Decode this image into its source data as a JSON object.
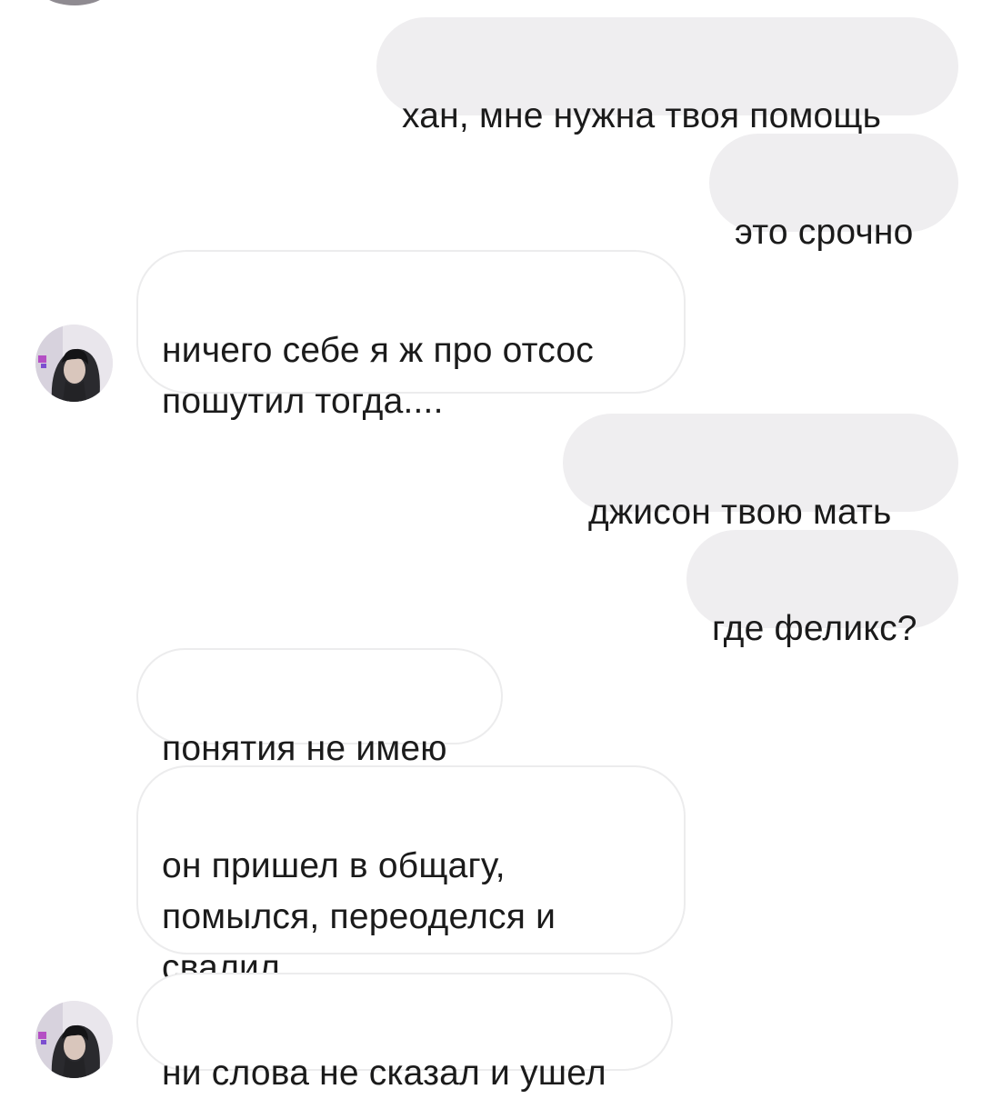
{
  "chat": {
    "messages": [
      {
        "direction": "sent",
        "text": "хан, мне нужна твоя помощь"
      },
      {
        "direction": "sent",
        "text": "это срочно"
      },
      {
        "direction": "received",
        "text": "ничего себе я ж про отсос\nпошутил тогда...."
      },
      {
        "direction": "sent",
        "text": "джисон твою мать"
      },
      {
        "direction": "sent",
        "text": "где феликс?"
      },
      {
        "direction": "received",
        "text": "понятия не имею"
      },
      {
        "direction": "received",
        "text": "он пришел в общагу,\nпомылся, переоделся и\nсвалил"
      },
      {
        "direction": "received",
        "text": "ни слова не сказал и ушел"
      }
    ]
  },
  "colors": {
    "sent_bubble": "#efeef0",
    "received_border": "#ececed",
    "text": "#1b1b1b",
    "background": "#ffffff"
  }
}
